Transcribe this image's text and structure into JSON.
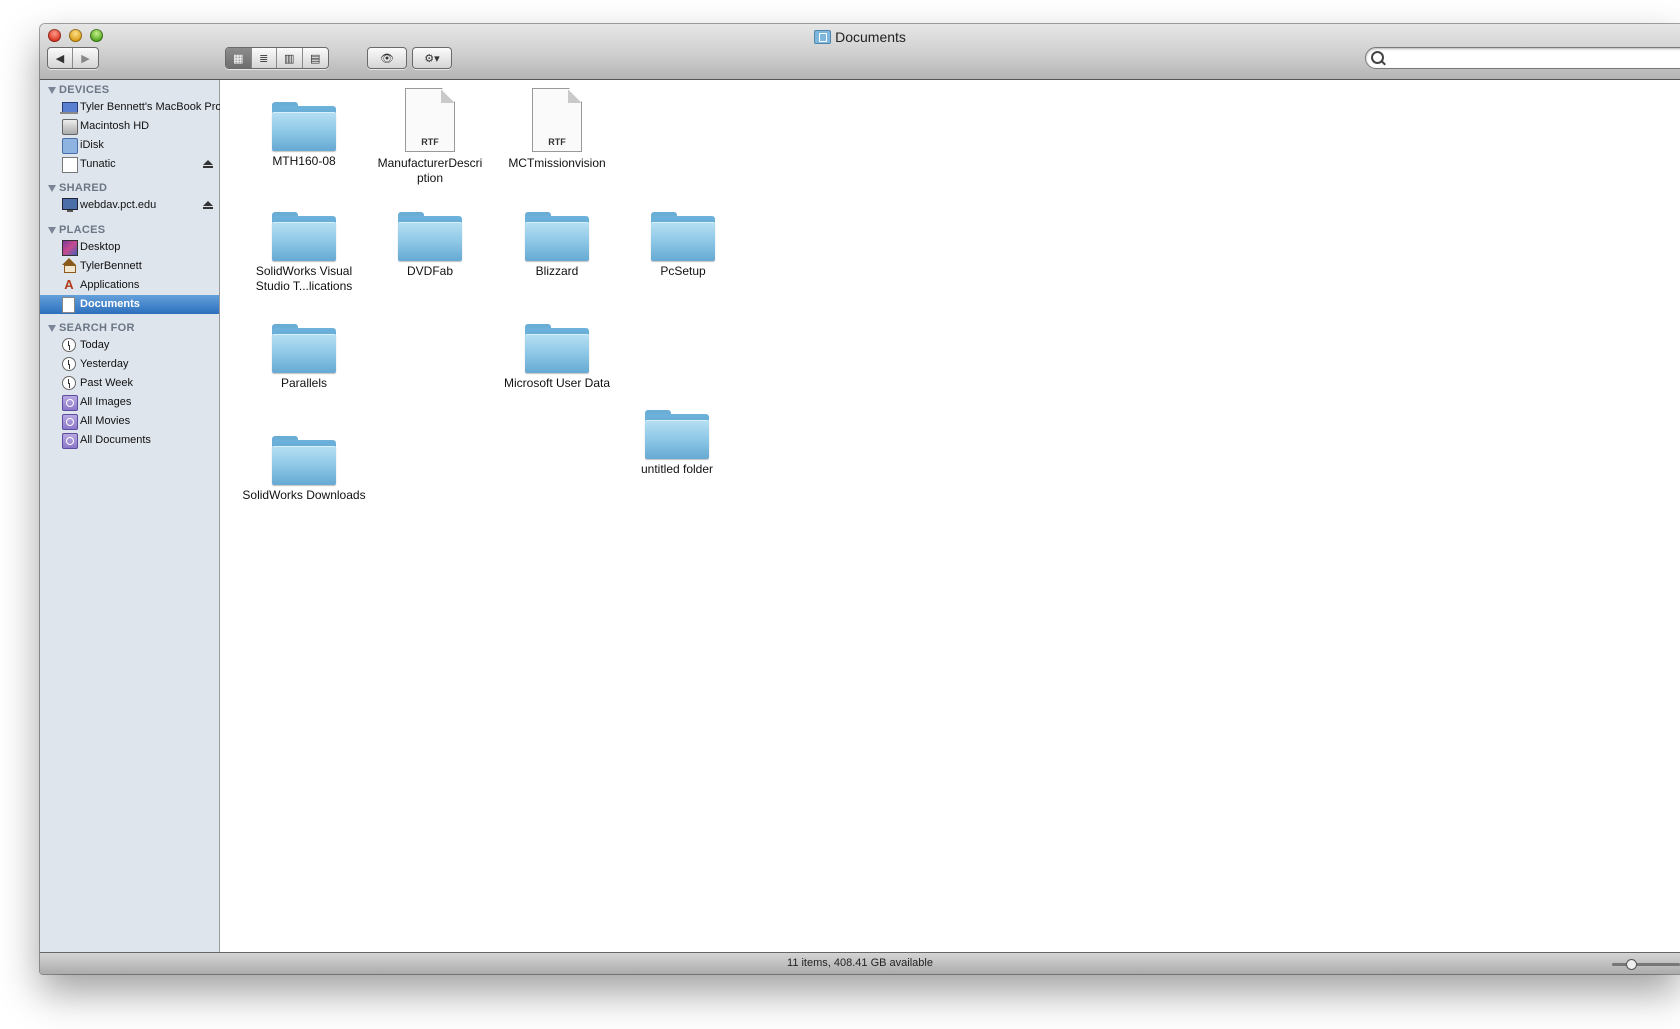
{
  "window": {
    "title": "Documents"
  },
  "toolbar": {
    "back_label": "◀",
    "forward_label": "▶",
    "view_icon": "▦",
    "view_list": "≣",
    "view_column": "▥",
    "view_coverflow": "▤",
    "quicklook": "👁",
    "action": "⚙▾",
    "search_placeholder": ""
  },
  "sidebar": {
    "devices_heading": "DEVICES",
    "devices": [
      "Tyler Bennett's MacBook Pro",
      "Macintosh HD",
      "iDisk",
      "Tunatic"
    ],
    "shared_heading": "SHARED",
    "shared": [
      "webdav.pct.edu"
    ],
    "places_heading": "PLACES",
    "places": [
      "Desktop",
      "TylerBennett",
      "Applications",
      "Documents"
    ],
    "search_heading": "SEARCH FOR",
    "search": [
      "Today",
      "Yesterday",
      "Past Week",
      "All Images",
      "All Movies",
      "All Documents"
    ],
    "apps_glyph": "A"
  },
  "files": [
    {
      "name": "MTH160-08",
      "kind": "folder"
    },
    {
      "name": "ManufacturerDescri ption",
      "kind": "rtf",
      "badge": "RTF"
    },
    {
      "name": "MCTmissionvision",
      "kind": "rtf",
      "badge": "RTF"
    },
    {
      "name": "SolidWorks Visual Studio T...lications",
      "kind": "folder"
    },
    {
      "name": "DVDFab",
      "kind": "folder"
    },
    {
      "name": "Blizzard",
      "kind": "folder"
    },
    {
      "name": "PcSetup",
      "kind": "folder"
    },
    {
      "name": "Parallels",
      "kind": "folder"
    },
    {
      "name": "Microsoft User Data",
      "kind": "folder"
    },
    {
      "name": "untitled folder",
      "kind": "folder"
    },
    {
      "name": "SolidWorks Downloads",
      "kind": "folder"
    }
  ],
  "status": {
    "text": "11 items, 408.41 GB available"
  },
  "colors": {
    "selection": "#3a7cc6",
    "sidebar_bg": "#dfe5ed",
    "folder": "#8cc7e6"
  }
}
